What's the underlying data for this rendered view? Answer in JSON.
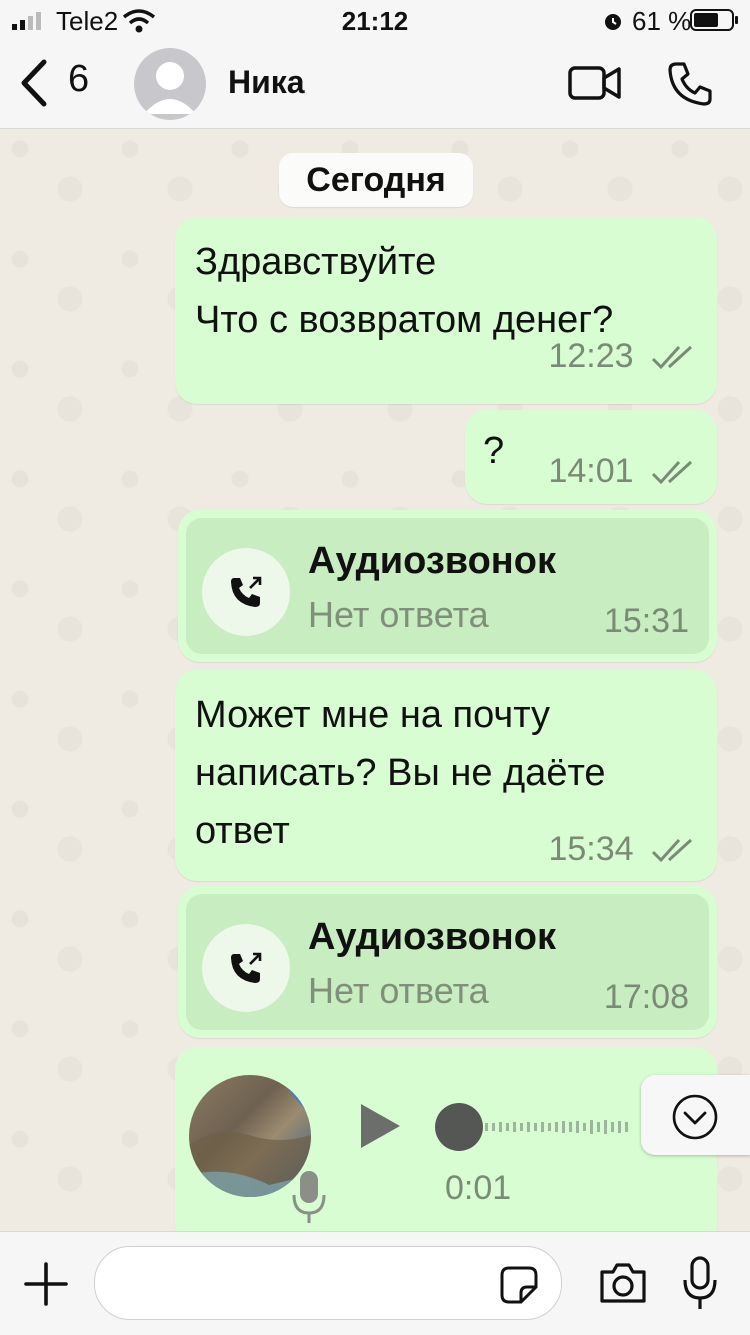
{
  "status_bar": {
    "carrier": "Tele2",
    "time": "21:12",
    "battery_percent": "61 %"
  },
  "header": {
    "back_count": "6",
    "contact_name": "Ника"
  },
  "chat": {
    "date_label": "Сегодня",
    "messages": [
      {
        "type": "text",
        "text": "Здравствуйте\nЧто с возвратом денег?",
        "time": "12:23"
      },
      {
        "type": "text",
        "text": "?",
        "time": "14:01"
      },
      {
        "type": "call",
        "title": "Аудиозвонок",
        "subtitle": "Нет ответа",
        "time": "15:31"
      },
      {
        "type": "text",
        "text": "Может мне на почту\nнаписать? Вы не даёте\nответ",
        "time": "15:34"
      },
      {
        "type": "call",
        "title": "Аудиозвонок",
        "subtitle": "Нет ответа",
        "time": "17:08"
      },
      {
        "type": "voice",
        "duration": "0:01"
      }
    ]
  },
  "colors": {
    "bubble": "#d9fdd3",
    "call_card": "#c8edc0",
    "background": "#efeae2"
  }
}
